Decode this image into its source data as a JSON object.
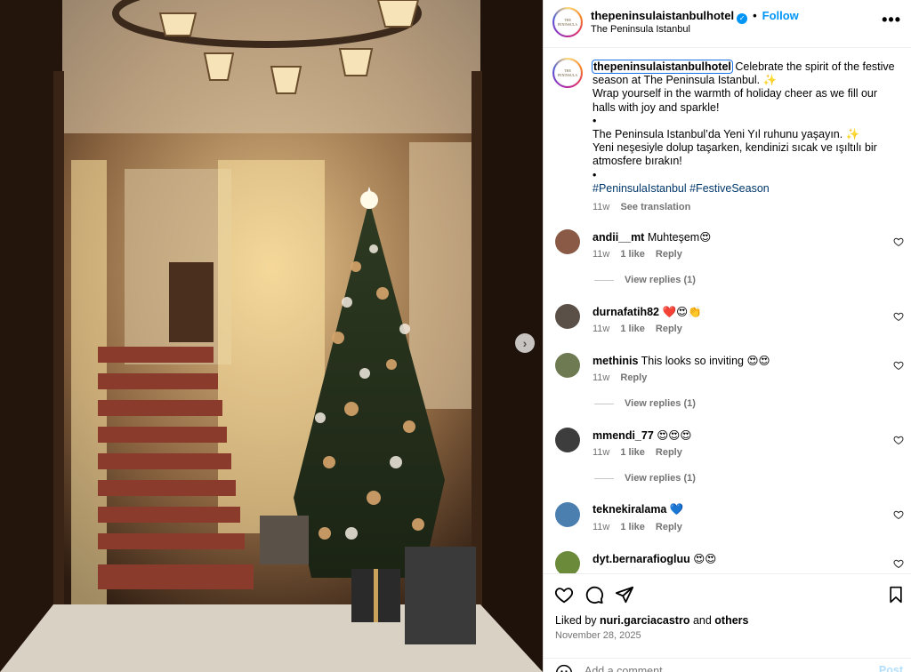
{
  "post": {
    "username": "thepeninsulaistanbulhotel",
    "location": "The Peninsula Istanbul",
    "follow_label": "Follow",
    "avatar_text": "THE PENINSULA",
    "more_label": "•••",
    "verified_mark": "✓"
  },
  "caption": {
    "username": "thepeninsulaistanbulhotel",
    "line1": "Celebrate the spirit of the festive season at The Peninsula Istanbul. ✨",
    "line2": "Wrap yourself in the warmth of holiday cheer as we fill our halls with joy and sparkle!",
    "bullet1": "•",
    "line3": "The Peninsula Istanbul’da Yeni Yıl ruhunu yaşayın. ✨",
    "line4": "Yeni neşesiyle dolup taşarken, kendinizi sıcak ve ışıltılı bir atmosfere bırakın!",
    "bullet2": "•",
    "hashtags": "#PeninsulaIstanbul #FestiveSeason",
    "time": "11w",
    "translate": "See translation"
  },
  "comments": [
    {
      "user": "andii__mt",
      "text": "Muhteşem😍",
      "time": "11w",
      "likes": "1 like",
      "reply": "Reply",
      "view_replies": "View replies (1)",
      "avatar_color": "#8a5a46"
    },
    {
      "user": "durnafatih82",
      "text": "❤️😍👏",
      "time": "11w",
      "likes": "1 like",
      "reply": "Reply",
      "view_replies": "",
      "avatar_color": "#5a5048"
    },
    {
      "user": "methinis",
      "text": "This looks so inviting 😍😍",
      "time": "11w",
      "likes": "",
      "reply": "Reply",
      "view_replies": "View replies (1)",
      "avatar_color": "#6e7a52"
    },
    {
      "user": "mmendi_77",
      "text": "😍😍😍",
      "time": "11w",
      "likes": "1 like",
      "reply": "Reply",
      "view_replies": "View replies (1)",
      "avatar_color": "#3d3d3d"
    },
    {
      "user": "teknekiralama",
      "text": "💙",
      "time": "11w",
      "likes": "1 like",
      "reply": "Reply",
      "view_replies": "",
      "avatar_color": "#4a7fb0"
    },
    {
      "user": "dyt.bernarafiogluu",
      "text": "😍😍",
      "time": "",
      "likes": "",
      "reply": "",
      "view_replies": "",
      "avatar_color": "#6b8a3a"
    }
  ],
  "footer": {
    "liked_prefix": "Liked by ",
    "liked_user": "nuri.garciacastro",
    "liked_and": " and ",
    "liked_others": "others",
    "date": "November 28, 2025",
    "comment_placeholder": "Add a comment...",
    "post_label": "Post"
  },
  "carousel": {
    "next_label": "›"
  },
  "colors": {
    "accent": "#0095f6",
    "hashtag": "#00376b",
    "muted": "#737373"
  }
}
